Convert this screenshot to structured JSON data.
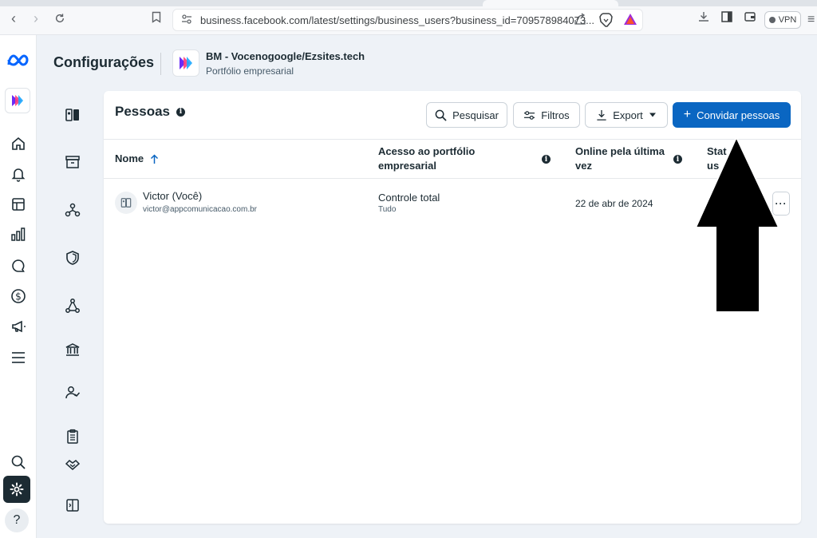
{
  "browser": {
    "url": "business.facebook.com/latest/settings/business_users?business_id=709578984073...",
    "vpn_label": "VPN"
  },
  "header": {
    "title": "Configurações",
    "business_name": "BM - Vocenogoogle/Ezsites.tech",
    "business_type": "Portfólio empresarial"
  },
  "card": {
    "title": "Pessoas",
    "search_label": "Pesquisar",
    "filters_label": "Filtros",
    "export_label": "Export",
    "invite_label": "Convidar pessoas"
  },
  "table": {
    "columns": {
      "name": "Nome",
      "access_line1": "Acesso ao portfólio",
      "access_line2": "empresarial",
      "online_line1": "Online pela última",
      "online_line2": "vez",
      "status_line1": "Stat",
      "status_line2": "us"
    },
    "rows": [
      {
        "name": "Victor (Você)",
        "email": "victor@appcomunicacao.com.br",
        "access": "Controle total",
        "access_sub": "Tudo",
        "online": "22 de abr de 2024"
      }
    ]
  },
  "colors": {
    "accent": "#0a66c2",
    "meta_blue": "#0866ff",
    "text": "#1c2b33"
  }
}
